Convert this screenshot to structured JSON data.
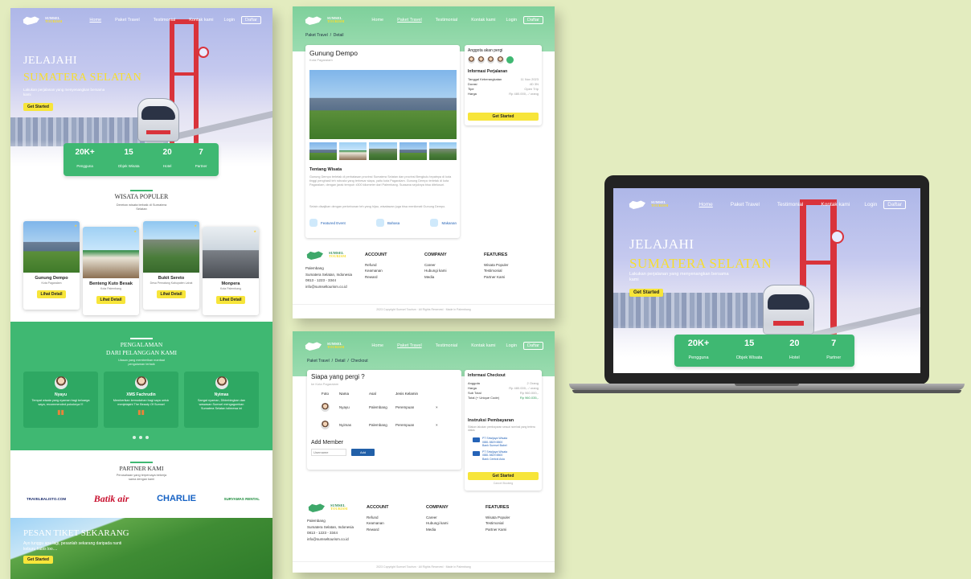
{
  "logo": {
    "line1": "SUMSEL",
    "line2": "TOURISM"
  },
  "nav": {
    "links": [
      "Home",
      "Paket Travel",
      "Testimonial",
      "Kontak kami"
    ],
    "login": "Login",
    "register": "Daftar"
  },
  "hero": {
    "title1": "JELAJAHI",
    "title2": "SUMATERA SELATAN",
    "subtitle": "Lakukan perjalanan yang menyenangkan bersama kami",
    "cta": "Get Started"
  },
  "stats": [
    {
      "value": "20K+",
      "label": "Pengguna"
    },
    {
      "value": "15",
      "label": "Objek Wisata"
    },
    {
      "value": "20",
      "label": "Hotel"
    },
    {
      "value": "7",
      "label": "Partner"
    }
  ],
  "popular": {
    "title": "WISATA POPULER",
    "subtitle": "Deretan wisata terbaik di Sumatera Selatan",
    "button": "Lihat Detail",
    "items": [
      {
        "name": "Gunung Dempo",
        "loc": "Kota Pagaralam"
      },
      {
        "name": "Benteng Kuto Besak",
        "loc": "Kota Palembang"
      },
      {
        "name": "Bukit Sereto",
        "loc": "Desa Pematang Kabupaten Lahat"
      },
      {
        "name": "Monpera",
        "loc": "Kota Palembang"
      }
    ]
  },
  "testimonials": {
    "title1": "PENGALAMAN",
    "title2": "DARI PELANGGAN KAMI",
    "subtitle": "Ulasan yang memberikan manfaat pengalaman terbaik",
    "items": [
      {
        "name": "Nyayu",
        "text": "Tempat wisata yang nyaman bagi keluarga saya, recommended pokoknya !!!"
      },
      {
        "name": "XMS Fachrudin",
        "text": "Memberikan kemudahan bagi saya untuk menjelajahi The Beauty Of Sumsel"
      },
      {
        "name": "Nyimas",
        "text": "Sangat nyaman, Dibimbingkan dan wawasan Sumsel mengagumkan Sumatera Selatan istimewa ini"
      }
    ]
  },
  "partners": {
    "title": "PARTNER KAMI",
    "subtitle": "Perusahaan yang terpercaya bekerja sama dengan kami",
    "logos": [
      "TRAVELBALISTO.COM",
      "Batik air",
      "CHARLIE",
      "SURYAMAS RENTAL"
    ]
  },
  "cta_band": {
    "title": "PESAN TIKET SEKARANG",
    "text": "Ayo tunggu apa lagi, pesanlah sekarang daripada nanti keburu habis loo....",
    "button": "Get Started"
  },
  "detail": {
    "crumb": [
      "Paket Travel",
      "/",
      "Detail"
    ],
    "name": "Gunung Dempo",
    "loc": "Kota Pagaralam",
    "about_title": "Tentang Wisata",
    "about_text": "Gunung Dempo terletak di perbatasan provinsi Sumatera Selatan dan provinsi Bengkulu tepatnya di kota tinggi penghasil teh robusta yang terbesar siapa, yaitu kota Pagaralam. Gunung Dempo terletak di kota Pagaralam, dengan jarak tempuh ±300 kilometer dari Palembang. Suasana sejuknya bisa ditelusuri.",
    "about_text2": "Selain disajikan dengan perkebunan teh yang hijau, wisatawan juga bisa menikmati Gunung Dempo.",
    "features": [
      {
        "label": "Featured Event"
      },
      {
        "label": "Bahasa"
      },
      {
        "label": "Makanan"
      }
    ],
    "members_title": "Anggota akan pergi",
    "info_title": "Informasi Perjalanan",
    "info": [
      {
        "k": "Tanggal Keberangkatan",
        "v": "11 Nov 2023"
      },
      {
        "k": "Durasi",
        "v": "4D 3N"
      },
      {
        "k": "Tipe",
        "v": "Open Trip"
      },
      {
        "k": "Harga",
        "v": "Rp 480.000,- / orang"
      }
    ],
    "cta": "Get Started"
  },
  "footer": {
    "address": [
      "Palembang",
      "Sumatera Selatan, Indonesia",
      "0813 - 1223 - 3344",
      "info@sumseltourism.co.id"
    ],
    "account_title": "ACCOUNT",
    "account": [
      "Refund",
      "Keamanan",
      "Reward"
    ],
    "company_title": "COMPANY",
    "company": [
      "Career",
      "Hubungi kami",
      "Media"
    ],
    "features_title": "FEATURES",
    "features": [
      "Wisata Populer",
      "Testimonial",
      "Partner Kami"
    ],
    "copyright": "2023 Copyright Sumsel Tourism · All Rights Reserved · Made in Palembang"
  },
  "checkout": {
    "crumb": [
      "Paket Travel",
      "/",
      "Detail",
      "/",
      "Checkout"
    ],
    "title": "Siapa yang pergi ?",
    "loc": "ke Kota Pagaralam",
    "headers": [
      "Foto",
      "Nama",
      "Asal",
      "Jenis Kelamin"
    ],
    "rows": [
      {
        "name": "Nyayu",
        "asal": "Palembang",
        "jk": "Perempuan"
      },
      {
        "name": "Nyimas",
        "asal": "Palembang",
        "jk": "Perempuan"
      }
    ],
    "remove": "×",
    "add_title": "Add Member",
    "add_placeholder": "Username",
    "add_button": "Add",
    "info_title": "Informasi Checkout",
    "info": [
      {
        "k": "Anggota",
        "v": "2 Orang"
      },
      {
        "k": "Harga",
        "v": "Rp 480.000,- / orang"
      },
      {
        "k": "Sub Total",
        "v": "Rp 960.000,-"
      },
      {
        "k": "Total (+ Unique Code)",
        "v": "Rp 960.035,-"
      }
    ],
    "pay_title": "Instruksi Pembayaran",
    "pay_text": "Silakan lakukan pembayaran sesuai nominal yang tertera diatas",
    "banks": [
      {
        "name": "PT Sriwijaya Wisata",
        "no": "0881 8829 8800",
        "bank": "Bank Sumsel Babel"
      },
      {
        "name": "PT Sriwijaya Wisata",
        "no": "0881 8829 8800",
        "bank": "Bank Central Asia"
      }
    ],
    "cta": "Get Started",
    "cancel": "Cancel Booking"
  },
  "colors": {
    "green": "#3fb872",
    "yellow": "#f7e53a",
    "bg": "#e3ecbf",
    "bridge_red": "#d9333b"
  }
}
